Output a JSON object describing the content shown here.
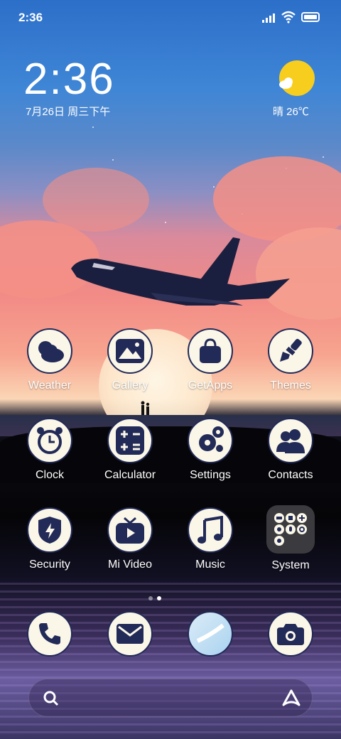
{
  "status_bar": {
    "time": "2:36"
  },
  "lock_widget": {
    "time": "2:36",
    "date": "7月26日 周三下午",
    "weather": "晴 26℃"
  },
  "apps_row1": [
    {
      "label": "Weather",
      "icon": "cloud-sun-icon"
    },
    {
      "label": "Gallery",
      "icon": "mountain-photo-icon"
    },
    {
      "label": "GetApps",
      "icon": "shopping-bag-icon"
    },
    {
      "label": "Themes",
      "icon": "paintbrush-icon"
    }
  ],
  "apps_row2": [
    {
      "label": "Clock",
      "icon": "alarm-clock-icon"
    },
    {
      "label": "Calculator",
      "icon": "calculator-icon"
    },
    {
      "label": "Settings",
      "icon": "gears-icon"
    },
    {
      "label": "Contacts",
      "icon": "people-icon"
    }
  ],
  "apps_row3": [
    {
      "label": "Security",
      "icon": "shield-bolt-icon"
    },
    {
      "label": "Mi Video",
      "icon": "tv-play-icon"
    },
    {
      "label": "Music",
      "icon": "music-note-icon"
    },
    {
      "label": "System",
      "icon": "folder-icon"
    }
  ],
  "dock": [
    {
      "icon": "phone-icon"
    },
    {
      "icon": "envelope-icon"
    },
    {
      "icon": "browser-icon"
    },
    {
      "icon": "camera-icon"
    }
  ],
  "pager": {
    "pages": 2,
    "active": 2
  },
  "search_bar": {
    "icon": "search-icon",
    "assistant_icon": "assistant-icon"
  }
}
